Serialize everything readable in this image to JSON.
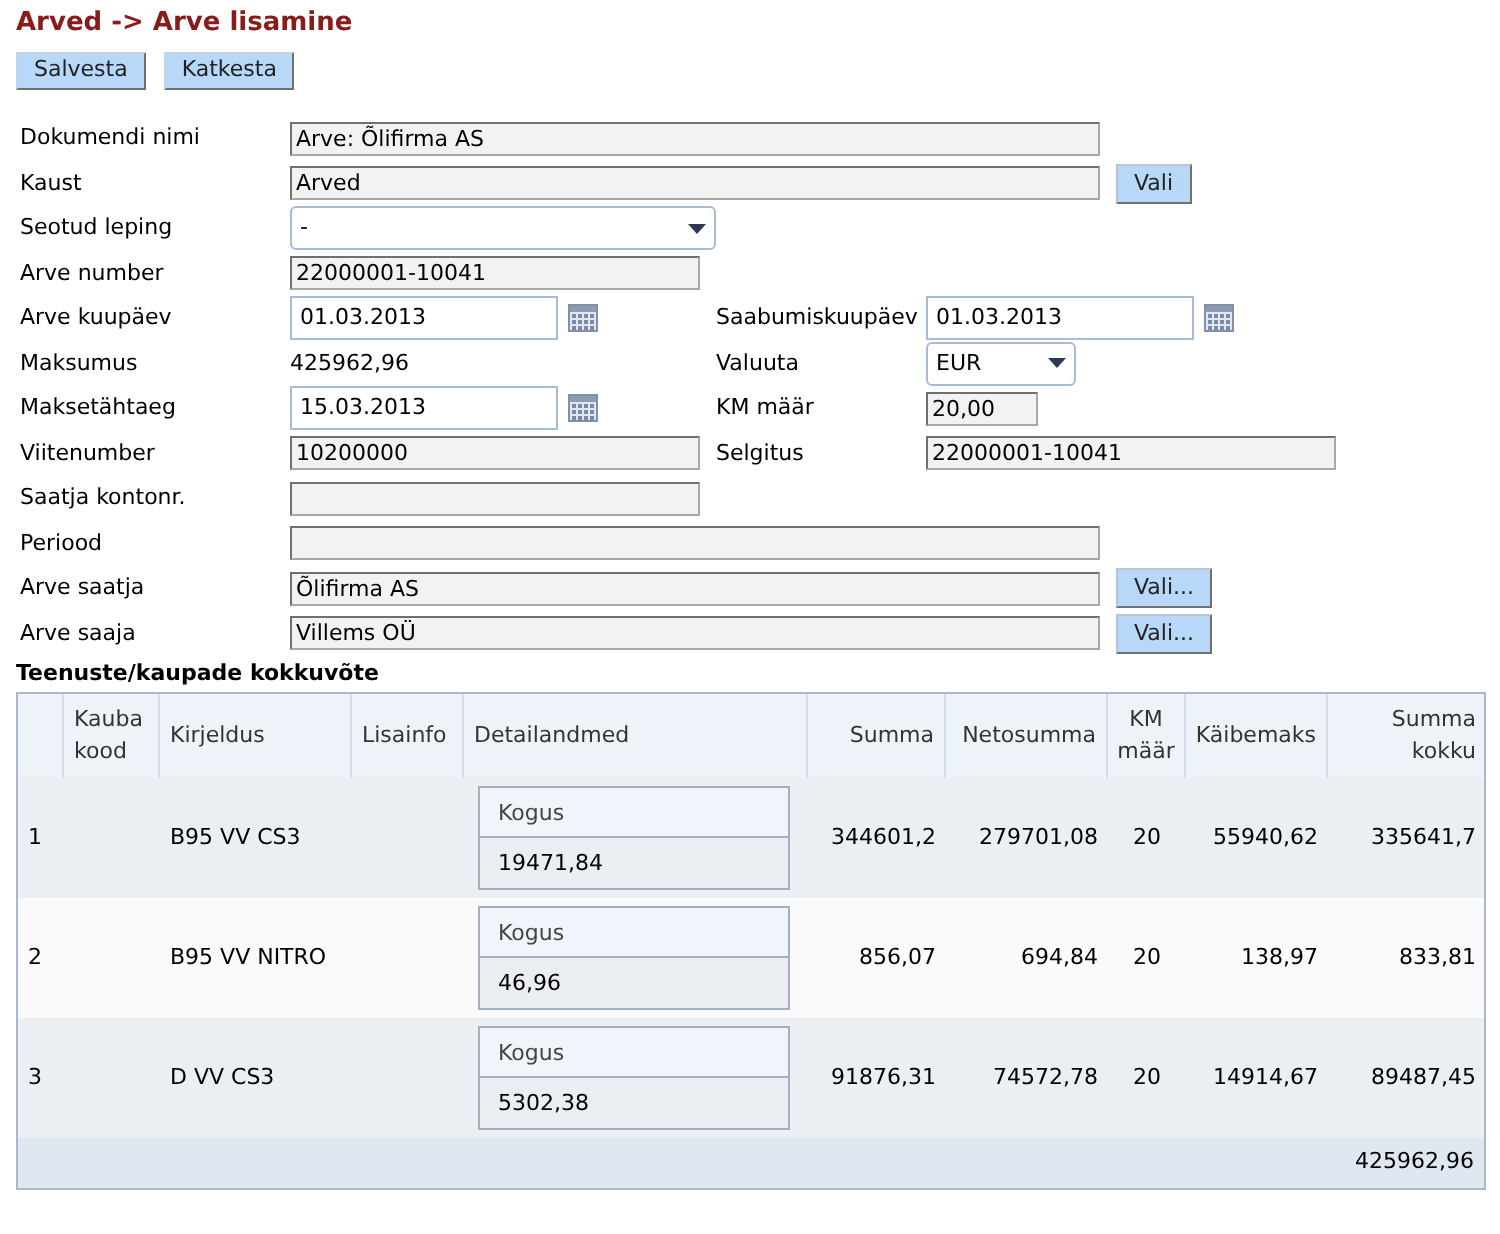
{
  "title": "Arved -> Arve lisamine",
  "toolbar": [
    "Salvesta",
    "Katkesta"
  ],
  "form_rows": [
    {
      "left": {
        "label": "Dokumendi nimi",
        "kind": "wide",
        "value": "Arve: Õlifirma AS"
      }
    },
    {
      "left": {
        "label": "Kaust",
        "kind": "wide",
        "value": "Arved",
        "button": "Vali"
      }
    },
    {
      "left": {
        "label": "Seotud leping",
        "kind": "select_wide",
        "value": "-"
      }
    },
    {
      "left": {
        "label": "Arve number",
        "kind": "medium",
        "value": "22000001-10041"
      }
    },
    {
      "left": {
        "label": "Arve kuupäev",
        "kind": "date",
        "value": "01.03.2013"
      },
      "right": {
        "label": "Saabumiskuupäev",
        "kind": "date",
        "value": "01.03.2013"
      }
    },
    {
      "left": {
        "label": "Maksumus",
        "kind": "text",
        "value": "425962,96"
      },
      "right": {
        "label": "Valuuta",
        "kind": "select_short",
        "value": "EUR"
      }
    },
    {
      "left": {
        "label": "Maksetähtaeg",
        "kind": "date",
        "value": "15.03.2013"
      },
      "right": {
        "label": "KM määr",
        "kind": "tiny",
        "value": "20,00"
      }
    },
    {
      "left": {
        "label": "Viitenumber",
        "kind": "medium",
        "value": "10200000"
      },
      "right": {
        "label": "Selgitus",
        "kind": "medium",
        "value": "22000001-10041"
      }
    },
    {
      "left": {
        "label": "Saatja kontonr.",
        "kind": "medium"
      }
    },
    {
      "left": {
        "label": "Periood",
        "kind": "wide"
      }
    },
    {
      "left": {
        "label": "Arve saatja",
        "kind": "wide",
        "value": "Õlifirma AS",
        "button": "Vali..."
      }
    },
    {
      "left": {
        "label": "Arve saaja",
        "kind": "wide",
        "value": "Villems OÜ",
        "button": "Vali..."
      }
    }
  ],
  "section_title": "Teenuste/kaupade kokkuvõte",
  "table": {
    "columns": [
      "",
      "Kauba kood",
      "Kirjeldus",
      "Lisainfo",
      "Detailandmed",
      "Summa",
      "Netosumma",
      "KM määr",
      "Käibemaks",
      "Summa kokku"
    ],
    "rows": [
      {
        "nr": "1",
        "kauba_kood": "",
        "kirjeldus": "B95 VV CS3",
        "lisainfo": "",
        "detail_label": "Kogus",
        "detail_value": "19471,84",
        "summa": "344601,2",
        "netosumma": "279701,08",
        "km": "20",
        "kaibemaks": "55940,62",
        "summa_kokku": "335641,7"
      },
      {
        "nr": "2",
        "kauba_kood": "",
        "kirjeldus": "B95 VV NITRO",
        "lisainfo": "",
        "detail_label": "Kogus",
        "detail_value": "46,96",
        "summa": "856,07",
        "netosumma": "694,84",
        "km": "20",
        "kaibemaks": "138,97",
        "summa_kokku": "833,81"
      },
      {
        "nr": "3",
        "kauba_kood": "",
        "kirjeldus": "D VV CS3",
        "lisainfo": "",
        "detail_label": "Kogus",
        "detail_value": "5302,38",
        "summa": "91876,31",
        "netosumma": "74572,78",
        "km": "20",
        "kaibemaks": "14914,67",
        "summa_kokku": "89487,45"
      }
    ],
    "total": "425962,96"
  }
}
